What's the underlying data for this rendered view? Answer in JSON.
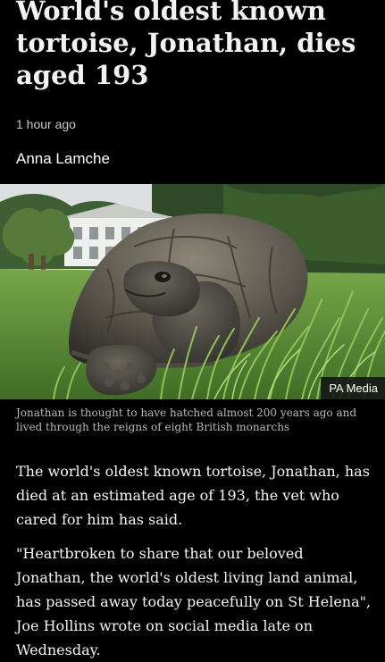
{
  "article": {
    "headline": "World's oldest known tortoise, Jonathan, dies aged 193",
    "timestamp": "1 hour ago",
    "author": "Anna Lamche"
  },
  "image": {
    "alt": "Jonathan the tortoise on grass",
    "credit": "PA Media",
    "caption": "Jonathan is thought to have hatched almost 200 years ago and lived through the reigns of eight British monarchs"
  },
  "body": {
    "paragraphs": [
      "The world's oldest known tortoise, Jonathan, has died at an estimated age of 193, the vet who cared for him has said.",
      "\"Heartbroken to share that our beloved Jonathan, the world's oldest living land animal, has passed away today peacefully on St Helena\", Joe Hollins wrote on social media late on Wednesday."
    ]
  }
}
